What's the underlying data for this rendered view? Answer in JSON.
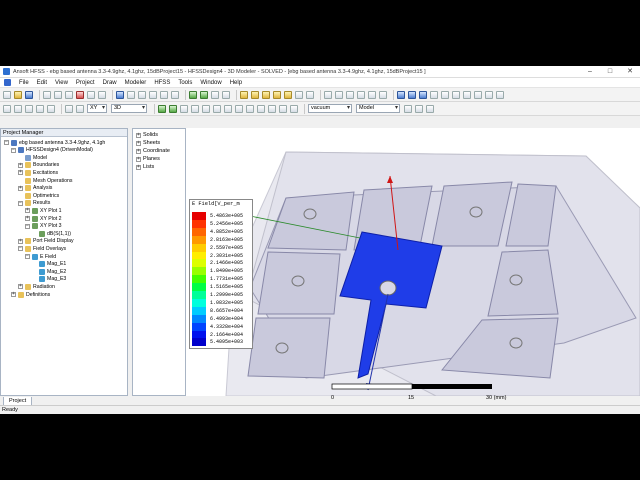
{
  "window": {
    "title": "Ansoft HFSS - ebg based antenna 3.3-4.9ghz, 4.1ghz, 15dBProject15 - HFSSDesign4 - 3D Modeler - SOLVED - [ebg based antenna 3.3-4.9ghz, 4.1ghz, 15dBProject15 ]",
    "controls": [
      "–",
      "□",
      "✕"
    ]
  },
  "menu": [
    "File",
    "Edit",
    "View",
    "Project",
    "Draw",
    "Modeler",
    "HFSS",
    "Tools",
    "Window",
    "Help"
  ],
  "toolbar": {
    "plane": "XY",
    "dimension": "3D",
    "material": "vacuum",
    "mode": "Model"
  },
  "project_manager": {
    "header": "Project Manager",
    "tab": "Project",
    "tree": [
      {
        "label": "ebg based antenna 3.3-4.9ghz, 4.1gh",
        "level": 0,
        "exp": "−",
        "icon": "proj"
      },
      {
        "label": "HFSSDesign4 (DrivenModal)",
        "level": 1,
        "exp": "−",
        "icon": "proj"
      },
      {
        "label": "Model",
        "level": 2,
        "exp": "",
        "icon": "doc"
      },
      {
        "label": "Boundaries",
        "level": 2,
        "exp": "+",
        "icon": "folder"
      },
      {
        "label": "Excitations",
        "level": 2,
        "exp": "+",
        "icon": "folder"
      },
      {
        "label": "Mesh Operations",
        "level": 2,
        "exp": "",
        "icon": "folder"
      },
      {
        "label": "Analysis",
        "level": 2,
        "exp": "+",
        "icon": "folder"
      },
      {
        "label": "Optimetrics",
        "level": 2,
        "exp": "",
        "icon": "folder"
      },
      {
        "label": "Results",
        "level": 2,
        "exp": "−",
        "icon": "folder"
      },
      {
        "label": "XY Plot 1",
        "level": 3,
        "exp": "+",
        "icon": "plot"
      },
      {
        "label": "XY Plot 2",
        "level": 3,
        "exp": "+",
        "icon": "plot"
      },
      {
        "label": "XY Plot 3",
        "level": 3,
        "exp": "−",
        "icon": "plot"
      },
      {
        "label": "dB(S(1,1))",
        "level": 4,
        "exp": "",
        "icon": "plot"
      },
      {
        "label": "Port Field Display",
        "level": 2,
        "exp": "+",
        "icon": "folder"
      },
      {
        "label": "Field Overlays",
        "level": 2,
        "exp": "−",
        "icon": "folder"
      },
      {
        "label": "E Field",
        "level": 3,
        "exp": "−",
        "icon": "field"
      },
      {
        "label": "Mag_E1",
        "level": 4,
        "exp": "",
        "icon": "field"
      },
      {
        "label": "Mag_E2",
        "level": 4,
        "exp": "",
        "icon": "field"
      },
      {
        "label": "Mag_E3",
        "level": 4,
        "exp": "",
        "icon": "field"
      },
      {
        "label": "Radiation",
        "level": 2,
        "exp": "+",
        "icon": "folder"
      },
      {
        "label": "Definitions",
        "level": 1,
        "exp": "+",
        "icon": "folder"
      }
    ]
  },
  "model_tree": [
    "Solids",
    "Sheets",
    "Coordinate",
    "Planes",
    "Lists"
  ],
  "legend": {
    "title": "E Field[V_per_m",
    "values": [
      "5.4863e+005",
      "5.2456e+005",
      "4.8852e+005",
      "2.8163e+005",
      "2.5597e+005",
      "2.3031e+005",
      "2.1466e+005",
      "1.8490e+005",
      "1.7731e+005",
      "1.5165e+005",
      "1.2999e+005",
      "1.0832e+005",
      "8.6657e+004",
      "6.4993e+004",
      "4.3328e+004",
      "2.1664e+004",
      "5.4095e+003"
    ],
    "colors": [
      "#e60000",
      "#ff3300",
      "#ff6600",
      "#ff9900",
      "#ffcc00",
      "#ffee00",
      "#ddff00",
      "#99ff00",
      "#44ff00",
      "#00ff44",
      "#00ff99",
      "#00ffdd",
      "#00ccff",
      "#0088ff",
      "#0044ff",
      "#0011ee",
      "#0000cc"
    ]
  },
  "scale": {
    "labels": [
      "0",
      "15",
      "30 (mm)"
    ]
  },
  "status": "Ready"
}
